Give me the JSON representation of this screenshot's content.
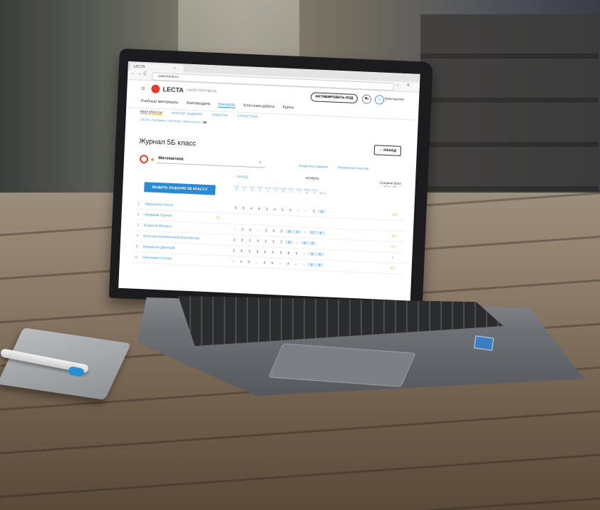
{
  "browser": {
    "tab_title": "LECTA",
    "tab_close": "×",
    "back_glyph": "←",
    "forward_glyph": "→",
    "reload_glyph": "C",
    "url": "www.lecta.ru",
    "star_glyph": "☆",
    "menu_glyph": "≡"
  },
  "header": {
    "burger_glyph": "≡",
    "logo": "LECTA",
    "logo_sub": "| МОЙ ПОРТФЕЛЬ",
    "activate": "АКТИВИРОВАТЬ КОД",
    "cart_glyph": "⛟",
    "avatar_glyph": "☺",
    "user": "Константин"
  },
  "main_nav": [
    "Учебные материалы",
    "Книговыдача",
    "Контроль",
    "Классная работа",
    "Курсы"
  ],
  "sub_nav": [
    "МОИ КЛАССЫ",
    "КАТАЛОГ ЗАДАНИЙ",
    "СОБЫТИЯ",
    "СТАТИСТИКА"
  ],
  "breadcrumbs": {
    "path": "LECTA » Портфель » Контроль » Мои классы » ",
    "current": "5Б"
  },
  "page": {
    "title": "Журнал 5Б класс",
    "back_button": "← НАЗАД",
    "subject": "Математика",
    "subject_caret": "▾",
    "link_given": "Выданные задания",
    "link_manage": "Управление классом",
    "assign_button": "ВЫДАТЬ ЗАДАНИЕ 5Б КЛАССУ",
    "nav_back": "← НАЗАД",
    "month": "НОЯБРЬ",
    "avg_title": "Средний балл",
    "avg_sub": "(за уч. год)"
  },
  "dates": [
    {
      "d": "2.11",
      "w": "П"
    },
    {
      "d": "4.11",
      "w": "С"
    },
    {
      "d": "6.11",
      "w": "С"
    },
    {
      "d": "8.11",
      "w": "С"
    },
    {
      "d": "10.11",
      "w": "С"
    },
    {
      "d": "12.11",
      "w": "Г"
    },
    {
      "d": "14.11",
      "w": "И"
    },
    {
      "d": "16.11",
      "w": "С"
    },
    {
      "d": "18.11",
      "w": "Г"
    },
    {
      "d": "18.11",
      "w": "И"
    },
    {
      "d": "22.11",
      "w": "С"
    },
    {
      "d": "28.11",
      "w": ""
    }
  ],
  "students": [
    {
      "num": "1",
      "name": "Авдошина Ольга",
      "warn": "",
      "marks": [
        "5",
        "5",
        "4",
        "5",
        "5",
        "4",
        "5",
        "5",
        "–",
        "–",
        "5",
        "8"
      ],
      "score": "4.6",
      "score_good": true
    },
    {
      "num": "2",
      "name": "Абрамов Сергей",
      "warn": "⚠",
      "marks": [
        "",
        "",
        "",
        "",
        "",
        "",
        "",
        "",
        "",
        "",
        "",
        ""
      ],
      "score": "",
      "score_good": false
    },
    {
      "num": "3",
      "name": "Борисов Михаил",
      "warn": "",
      "marks": [
        "–",
        "3",
        "5",
        "–",
        "3",
        "5",
        "5",
        "8",
        "8",
        "–",
        "3.7",
        "8"
      ],
      "score": "3.6",
      "score_good": false
    },
    {
      "num": "4",
      "name": "Константинопольский Константин",
      "warn": "",
      "marks": [
        "3",
        "3",
        "2",
        "3",
        "3",
        "2",
        "3",
        "8",
        "–",
        "8",
        "8",
        ""
      ],
      "score": "3.7",
      "score_good": false
    },
    {
      "num": "5",
      "name": "Маркелов Дмитрий",
      "warn": "",
      "marks": [
        "3",
        "5",
        "3",
        "3",
        "5",
        "3",
        "3",
        "5",
        "4",
        "–",
        "8",
        "8"
      ],
      "score": "4",
      "score_good": true
    },
    {
      "num": "6",
      "name": "Николаев Степан",
      "warn": "",
      "marks": [
        "–",
        "4",
        "5",
        "–",
        "4",
        "5",
        "–",
        "4",
        "–",
        "–",
        "8",
        "8"
      ],
      "score": "4.5",
      "score_good": true
    }
  ]
}
